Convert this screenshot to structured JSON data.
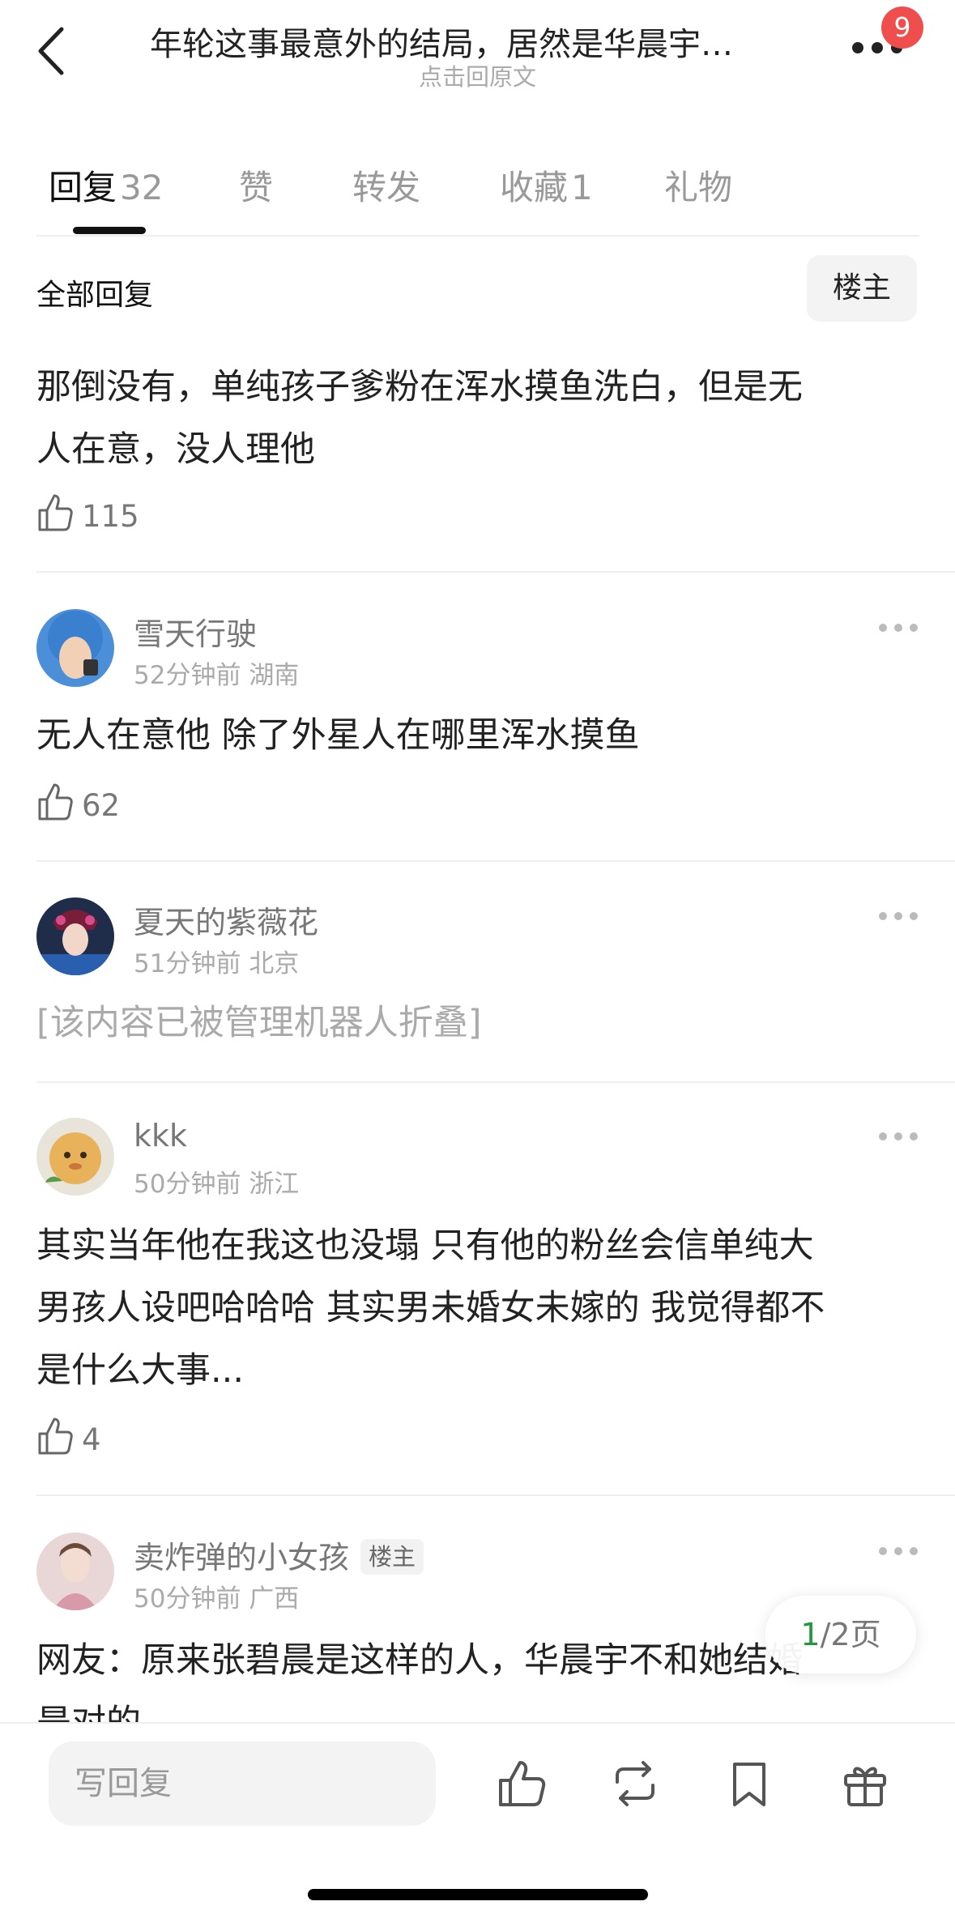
{
  "header": {
    "title": "年轮这事最意外的结局，居然是华晨宇…",
    "subtitle": "点击回原文",
    "badge_count": "9"
  },
  "tabs": [
    {
      "label": "回复",
      "count": "32",
      "active": true
    },
    {
      "label": "赞",
      "count": ""
    },
    {
      "label": "转发",
      "count": ""
    },
    {
      "label": "收藏",
      "count": "1"
    },
    {
      "label": "礼物",
      "count": ""
    }
  ],
  "filter": {
    "label": "全部回复",
    "button": "楼主"
  },
  "top_comment": {
    "text_line1": "那倒没有，单纯孩子爹粉在浑水摸鱼洗白，但是无",
    "text_line2": "人在意，没人理他",
    "likes": "115"
  },
  "comments": [
    {
      "name": "雪天行驶",
      "time": "52分钟前",
      "location": "湖南",
      "text": "无人在意他 除了外星人在哪里浑水摸鱼",
      "likes": "62"
    },
    {
      "name": "夏天的紫薇花",
      "time": "51分钟前",
      "location": "北京",
      "text": "[该内容已被管理机器人折叠]"
    },
    {
      "name": "kkk",
      "time": "50分钟前",
      "location": "浙江",
      "text_line1": "其实当年他在我这也没塌 只有他的粉丝会信单纯大",
      "text_line2": "男孩人设吧哈哈哈 其实男未婚女未嫁的 我觉得都不",
      "text_line3": "是什么大事...",
      "likes": "4"
    },
    {
      "name": "卖炸弹的小女孩",
      "tag": "楼主",
      "time": "50分钟前",
      "location": "广西",
      "text_line1": "网友：原来张碧晨是这样的人，华晨宇不和她结婚",
      "text_line2": "是对的"
    }
  ],
  "pagination": {
    "current": "1",
    "total": "/2页"
  },
  "bottom_bar": {
    "reply_placeholder": "写回复"
  },
  "icons": {
    "back": "back-arrow-icon",
    "more": "more-icon",
    "like": "thumbs-up-icon",
    "repost": "repost-icon",
    "bookmark": "bookmark-icon",
    "gift": "gift-icon"
  },
  "colors": {
    "badge": "#f04d4d",
    "page_current": "#1e9a3c",
    "text_secondary": "#aaaaaa"
  }
}
